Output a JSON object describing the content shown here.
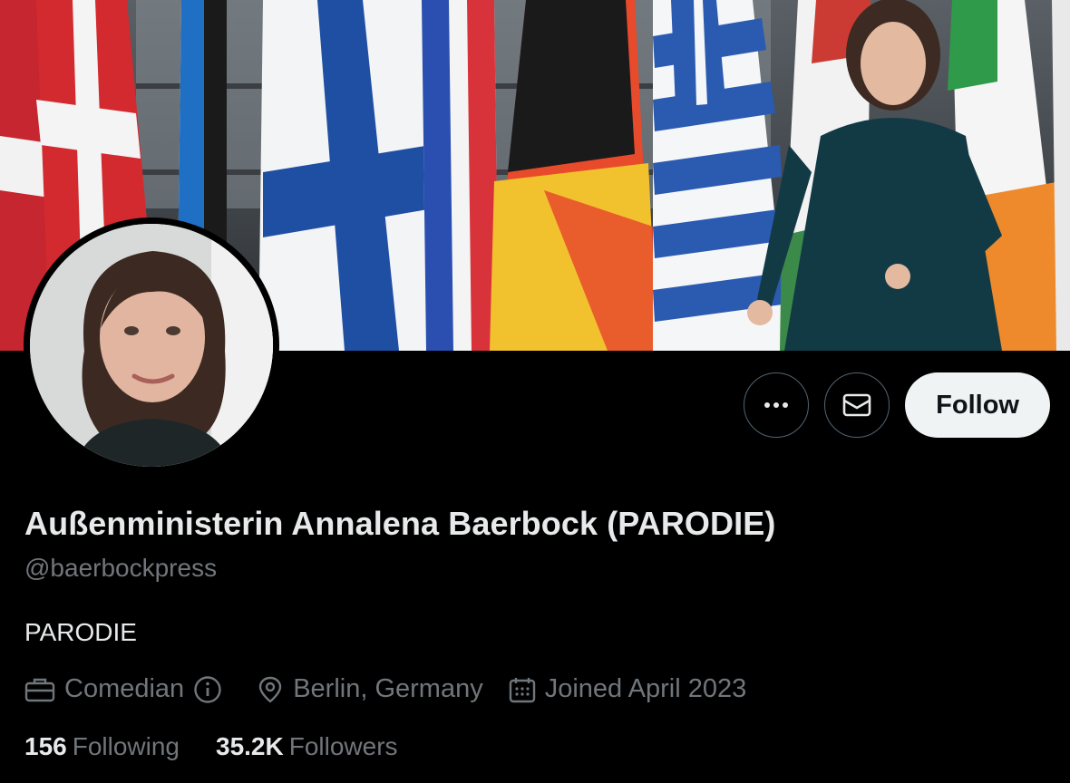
{
  "profile": {
    "display_name": "Außenministerin Annalena Baerbock (PARODIE)",
    "handle": "@baerbockpress",
    "bio": "PARODIE",
    "category": "Comedian",
    "location": "Berlin, Germany",
    "joined": "Joined April 2023",
    "following_count": "156",
    "following_label": "Following",
    "followers_count": "35.2K",
    "followers_label": "Followers"
  },
  "actions": {
    "more_icon": "more-horizontal-icon",
    "message_icon": "envelope-icon",
    "follow_label": "Follow"
  },
  "meta_icons": {
    "category": "briefcase-icon",
    "info": "info-icon",
    "location": "location-pin-icon",
    "joined": "calendar-icon"
  },
  "colors": {
    "background": "#000000",
    "primary_text": "#e7e9ea",
    "secondary_text": "#71767b",
    "button_border": "#536471",
    "follow_bg": "#eff3f4"
  }
}
